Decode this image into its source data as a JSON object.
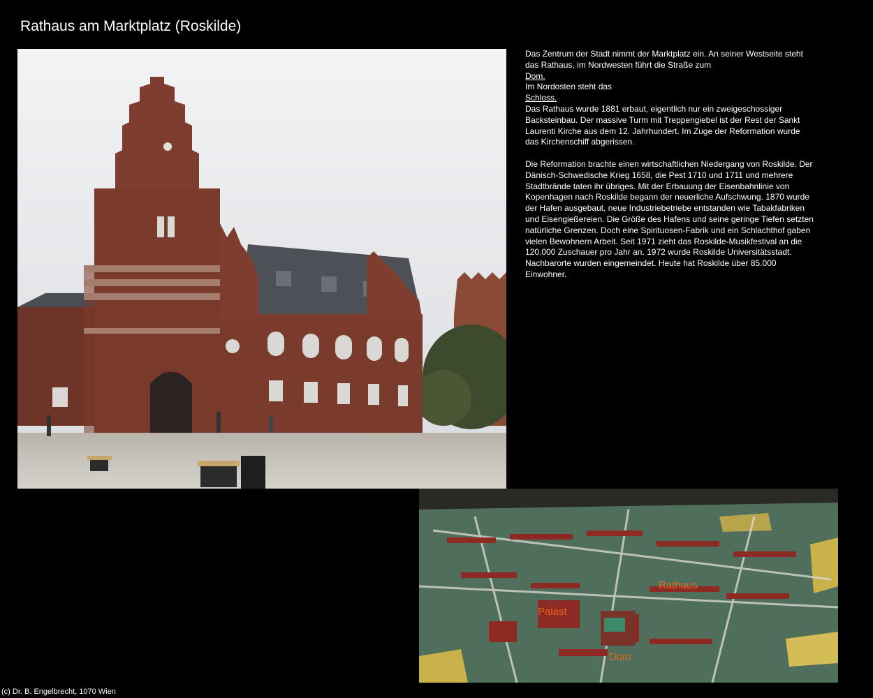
{
  "page": {
    "title": "Rathaus am Marktplatz (Roskilde)"
  },
  "images": {
    "main_photo_icon": "building-photo",
    "map_photo_icon": "city-model-photo",
    "map_labels": {
      "rathaus": "Rathaus",
      "palast": "Palast",
      "dom": "Dom"
    }
  },
  "article": {
    "intro": "Das Zentrum der Stadt nimmt der Marktplatz ein. An seiner Westseite steht das Rathaus, im Nordwesten führt die Straße zum",
    "link_dom": "Dom.",
    "line_nordosten": "Im Nordosten steht das",
    "link_schloss": "Schloss.",
    "paragraph_rathaus": "Das Rathaus wurde 1881 erbaut, eigentlich nur ein zweigeschossiger Backsteinbau. Der massive Turm mit Treppengiebel ist der Rest der Sankt Laurenti Kirche aus dem 12. Jahrhundert. Im Zuge der Reformation wurde das Kirchenschiff abgerissen.",
    "paragraph_history": "Die Reformation brachte einen wirtschaftlichen Niedergang von Roskilde. Der Dänisch-Schwedische Krieg 1658, die Pest 1710 und 1711 und mehrere Stadtbrände taten ihr übriges. Mit der Erbauung der Eisenbahnlinie von Kopenhagen nach Roskilde begann der neuerliche Aufschwung. 1870 wurde der Hafen ausgebaut, neue Industriebetriebe entstanden wie Tabakfabriken und Eisengießereien. Die Größe des Hafens und seine geringe Tiefen setzten natürliche Grenzen. Doch eine Spirituosen-Fabrik und ein Schlachthof gaben vielen Bewohnern Arbeit. Seit 1971 zieht das Roskilde-Musikfestival an die 120.000 Zuschauer pro Jahr an. 1972 wurde Roskilde Universitätsstadt. Nachbarorte wurden eingemeindet. Heute hat Roskilde über 85.000 Einwohner."
  },
  "footer": {
    "copyright": "(c) Dr. B. Engelbrecht, 1070 Wien"
  },
  "colors": {
    "background": "#000000",
    "text": "#ffffff",
    "map_label": "#e8661e",
    "brick": "#7a3a2c"
  }
}
